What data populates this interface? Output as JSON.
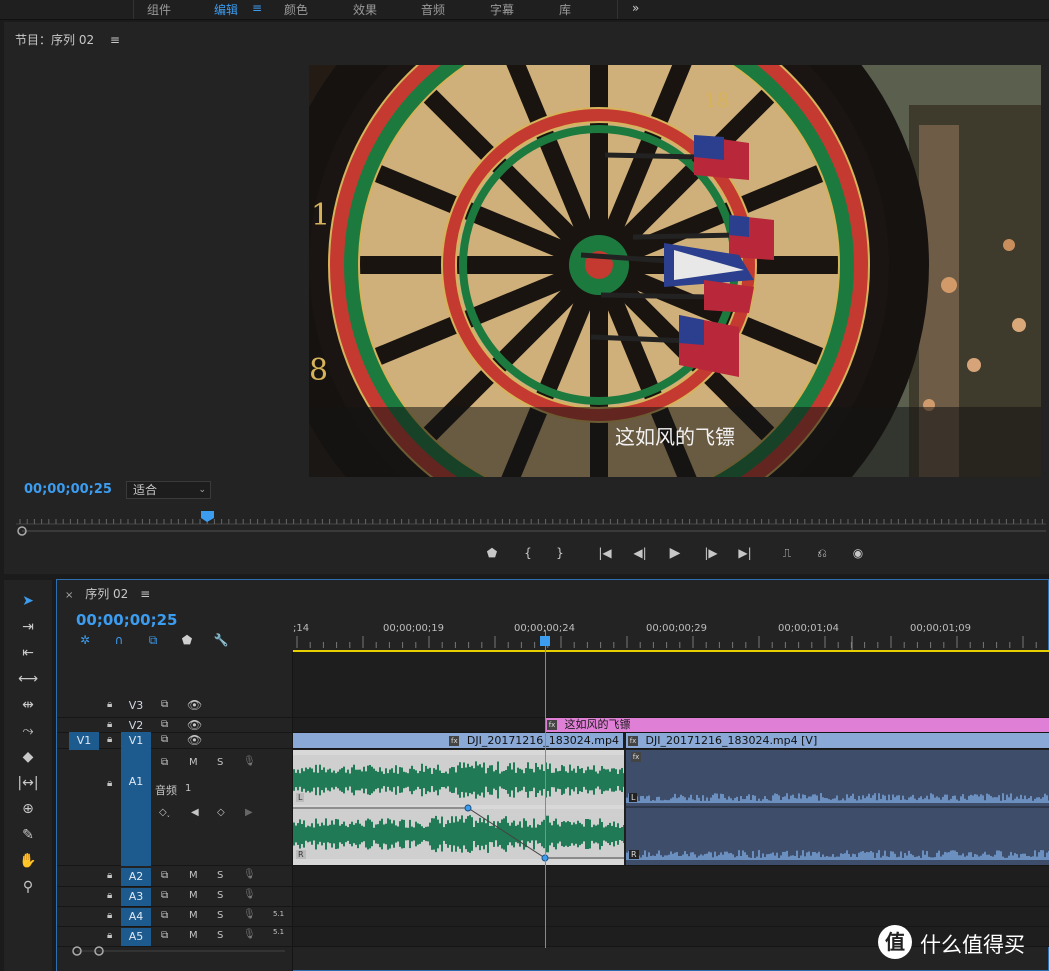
{
  "workspace_tabs": [
    {
      "label": "组件",
      "active": false
    },
    {
      "label": "编辑",
      "active": true
    },
    {
      "label": "颜色",
      "active": false
    },
    {
      "label": "效果",
      "active": false
    },
    {
      "label": "音频",
      "active": false
    },
    {
      "label": "字幕",
      "active": false
    },
    {
      "label": "库",
      "active": false
    }
  ],
  "program": {
    "title": "节目：序列 02",
    "subtitle": "这如风的飞镖",
    "timecode": "00;00;00;25",
    "fit": "适合"
  },
  "timeline": {
    "tab_label": "序列 02",
    "timecode": "00;00;00;25",
    "ruler_labels": [
      ";14",
      "00;00;00;19",
      "00;00;00;24",
      "00;00;00;29",
      "00;00;01;04",
      "00;00;01;09"
    ],
    "tracks": {
      "v3": "V3",
      "v2": "V2",
      "v1": "V1",
      "v1_source": "V1",
      "a1": "A1",
      "a1_name": "音频",
      "a1_num": "1",
      "a2": "A2",
      "a3": "A3",
      "a4": "A4",
      "a5": "A5",
      "mute": "M",
      "solo": "S",
      "level_51": "5.1"
    },
    "clips": {
      "title_clip": "这如风的飞镖",
      "video_clip_1": "DJI_20171216_183024.mp4",
      "video_clip_2": "DJI_20171216_183024.mp4 [V]",
      "ch_left": "L",
      "ch_right": "R"
    }
  },
  "watermark": "什么值得买",
  "colors": {
    "accent": "#3c9cf0",
    "title_clip": "#e07fd6",
    "video_clip": "#8aa9d6",
    "audio_clip_green": "#1f7a55",
    "audio_clip_blue": "#3e4d69"
  }
}
